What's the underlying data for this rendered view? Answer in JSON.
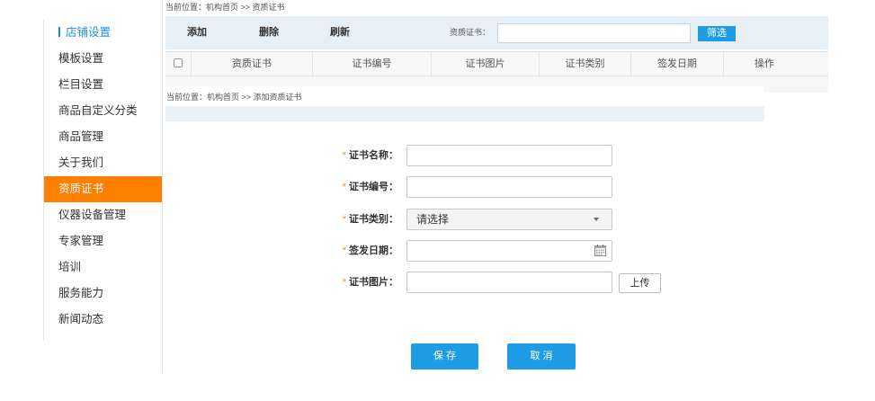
{
  "breadcrumb": "当前位置：机构首页 >> 资质证书",
  "colors": {
    "blue": "#1e9ce6",
    "orange": "#ff7f00",
    "nav-blue": "#1e8fe0",
    "required": "#ff8a1f",
    "toolbar-bg": "#e8f0f7",
    "band-bg": "#eaf2f8"
  },
  "icons": {
    "section_marker": "vertical-bar-icon",
    "header_checkbox": "checkbox-icon",
    "select_arrow": "chevron-down-icon",
    "date_picker": "calendar-icon"
  },
  "sidebar": {
    "items": [
      {
        "label": "店铺设置",
        "section_header": true
      },
      {
        "label": "模板设置"
      },
      {
        "label": "栏目设置"
      },
      {
        "label": "商品自定义分类"
      },
      {
        "label": "商品管理"
      },
      {
        "label": "关于我们"
      },
      {
        "label": "资质证书",
        "active": true
      },
      {
        "label": "仪器设备管理"
      },
      {
        "label": "专家管理"
      },
      {
        "label": "培训"
      },
      {
        "label": "服务能力"
      },
      {
        "label": "新闻动态"
      }
    ]
  },
  "toolbar": {
    "add": "添加",
    "delete": "删除",
    "refresh": "刷新",
    "filter_label": "资质证书：",
    "filter_value": "",
    "filter_button": "筛选"
  },
  "table": {
    "columns": [
      "资质证书",
      "证书编号",
      "证书图片",
      "证书类别",
      "签发日期",
      "操作"
    ]
  },
  "form": {
    "breadcrumb": "当前位置：机构首页 >> 添加资质证书",
    "required_marker": "*",
    "fields": [
      {
        "label": "证书名称：",
        "value": ""
      },
      {
        "label": "证书编号：",
        "value": ""
      },
      {
        "label": "证书类别：",
        "selected": "请选择"
      },
      {
        "label": "签发日期：",
        "value": ""
      },
      {
        "label": "证书图片：",
        "value": "",
        "upload_button": "上传"
      }
    ],
    "save_button": "保 存",
    "cancel_button": "取 消"
  }
}
